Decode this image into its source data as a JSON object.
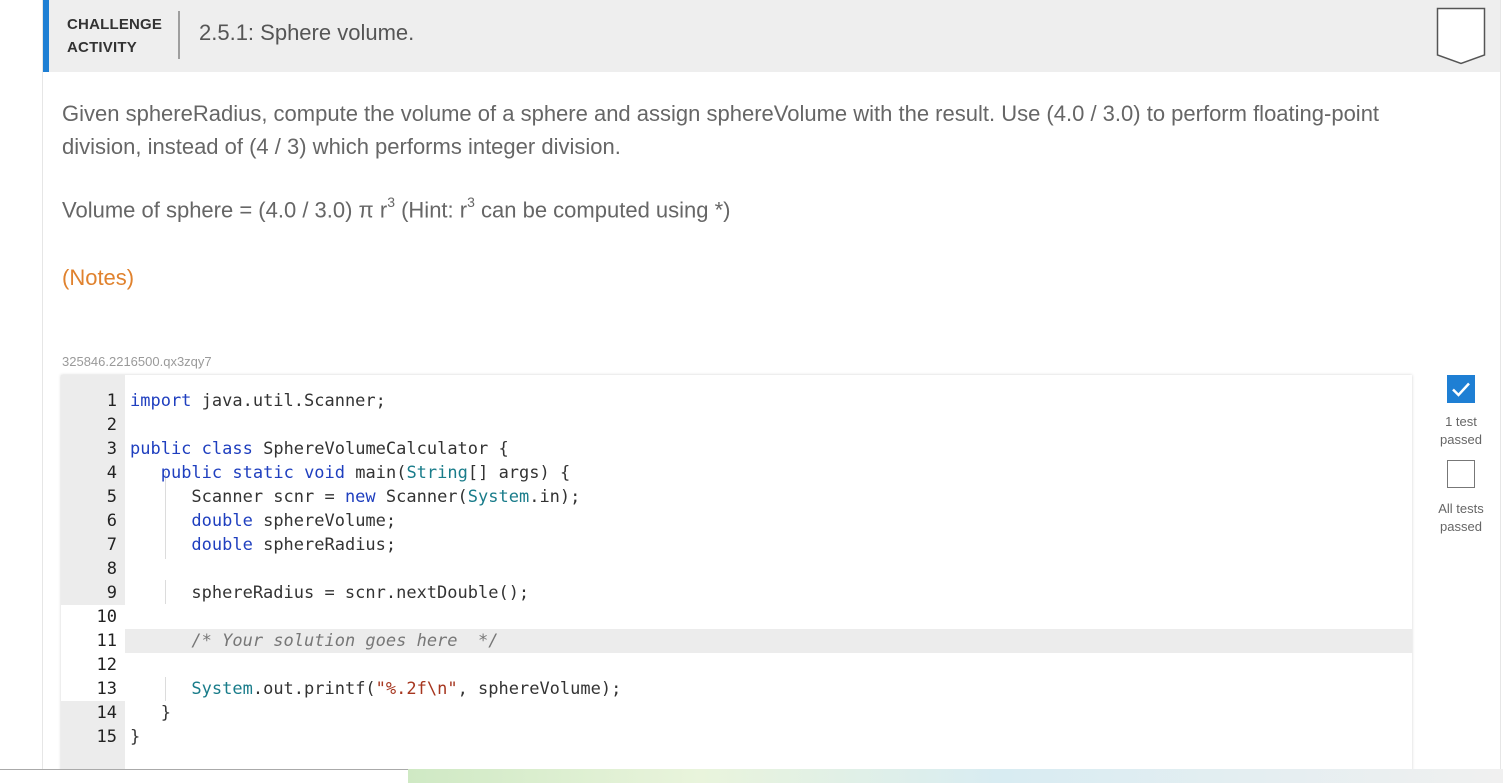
{
  "header": {
    "type_line1": "CHALLENGE",
    "type_line2": "ACTIVITY",
    "title": "2.5.1: Sphere volume."
  },
  "description": "Given sphereRadius, compute the volume of a sphere and assign sphereVolume with the result. Use (4.0 / 3.0) to perform floating-point division, instead of (4 / 3) which performs integer division.",
  "formula": {
    "text_before": "Volume of sphere = (4.0 / 3.0) π r",
    "exponent": "3",
    "hint_before": " (Hint: r",
    "hint_exponent": "3",
    "hint_after": " can be computed using *)"
  },
  "notes_link": "(Notes)",
  "activity_id": "325846.2216500.qx3zqy7",
  "code": {
    "line_numbers": [
      "1",
      "2",
      "3",
      "4",
      "5",
      "6",
      "7",
      "8",
      "9",
      "10",
      "11",
      "12",
      "13",
      "14",
      "15"
    ],
    "lines": [
      "import java.util.Scanner;",
      "",
      "public class SphereVolumeCalculator {",
      "   public static void main(String[] args) {",
      "      Scanner scnr = new Scanner(System.in);",
      "      double sphereVolume;",
      "      double sphereRadius;",
      "",
      "      sphereRadius = scnr.nextDouble();",
      "",
      "      /* Your solution goes here  */",
      "",
      "      System.out.printf(\"%.2f\\n\", sphereVolume);",
      "   }",
      "}"
    ]
  },
  "tests": {
    "test1_label": "1 test passed",
    "test2_label": "All tests passed",
    "test1_checked": true,
    "test2_checked": false
  },
  "colors": {
    "accent": "#1e7fd4",
    "notes": "#e0822e",
    "keyword": "#1f3fbf",
    "type": "#197c8a",
    "string": "#a6361f"
  },
  "icons": {
    "completion": "shield-outline-icon",
    "check": "checkmark-icon"
  }
}
